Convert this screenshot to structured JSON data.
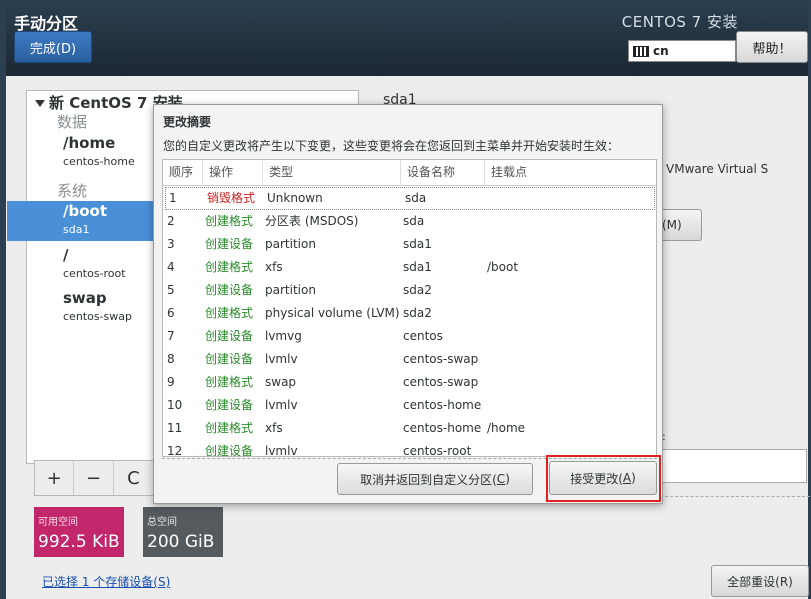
{
  "header": {
    "title": "手动分区",
    "done_label": "完成(D)",
    "product": "CENTOS 7 安装",
    "keyboard_layout": "cn",
    "help_label": "帮助！"
  },
  "left_panel": {
    "install_header": "新 CentOS 7 安装",
    "groups": {
      "data": "数据",
      "system": "系统"
    },
    "mounts": [
      {
        "name": "/home",
        "device": "centos-home"
      },
      {
        "name": "/boot",
        "device": "sda1"
      },
      {
        "name": "/",
        "device": "centos-root"
      },
      {
        "name": "swap",
        "device": "centos-swap"
      }
    ],
    "toolbar": {
      "add": "+",
      "remove": "−",
      "refresh": "C"
    }
  },
  "space": {
    "available_label": "可用空间",
    "available_value": "992.5 KiB",
    "total_label": "总空间",
    "total_value": "200 GiB"
  },
  "footer": {
    "storage_link": "已选择 1 个存储设备(S)",
    "reset_label": "全部重设(R)"
  },
  "right_partial": {
    "title": "sda1",
    "vmware": "VMware Virtual S",
    "button_suffix": "(M)",
    "colon": ":"
  },
  "dialog": {
    "title": "更改摘要",
    "description": "您的自定义更改将产生以下变更，这些变更将会在您返回到主菜单并开始安装时生效：",
    "columns": [
      "顺序",
      "操作",
      "类型",
      "设备名称",
      "挂载点"
    ],
    "rows": [
      {
        "order": "1",
        "action": "销毁格式",
        "kind": "destroy",
        "type": "Unknown",
        "device": "sda",
        "mount": ""
      },
      {
        "order": "2",
        "action": "创建格式",
        "kind": "create",
        "type": "分区表 (MSDOS)",
        "device": "sda",
        "mount": ""
      },
      {
        "order": "3",
        "action": "创建设备",
        "kind": "create",
        "type": "partition",
        "device": "sda1",
        "mount": ""
      },
      {
        "order": "4",
        "action": "创建格式",
        "kind": "create",
        "type": "xfs",
        "device": "sda1",
        "mount": "/boot"
      },
      {
        "order": "5",
        "action": "创建设备",
        "kind": "create",
        "type": "partition",
        "device": "sda2",
        "mount": ""
      },
      {
        "order": "6",
        "action": "创建格式",
        "kind": "create",
        "type": "physical volume (LVM)",
        "device": "sda2",
        "mount": ""
      },
      {
        "order": "7",
        "action": "创建设备",
        "kind": "create",
        "type": "lvmvg",
        "device": "centos",
        "mount": ""
      },
      {
        "order": "8",
        "action": "创建设备",
        "kind": "create",
        "type": "lvmlv",
        "device": "centos-swap",
        "mount": ""
      },
      {
        "order": "9",
        "action": "创建格式",
        "kind": "create",
        "type": "swap",
        "device": "centos-swap",
        "mount": ""
      },
      {
        "order": "10",
        "action": "创建设备",
        "kind": "create",
        "type": "lvmlv",
        "device": "centos-home",
        "mount": ""
      },
      {
        "order": "11",
        "action": "创建格式",
        "kind": "create",
        "type": "xfs",
        "device": "centos-home",
        "mount": "/home"
      },
      {
        "order": "12",
        "action": "创建设备",
        "kind": "create",
        "type": "lvmlv",
        "device": "centos-root",
        "mount": ""
      }
    ],
    "cancel_label_pre": "取消并返回到自定义分区(",
    "cancel_key": "C",
    "cancel_label_post": ")",
    "accept_label_pre": "接受更改(",
    "accept_key": "A",
    "accept_label_post": ")"
  },
  "colors": {
    "header_bg": "#1c2833",
    "accent": "#4a90d9",
    "available": "#c1276a",
    "total": "#555a5e",
    "destroy": "#cc2222",
    "create": "#2a8a2a",
    "highlight": "#e02020"
  }
}
